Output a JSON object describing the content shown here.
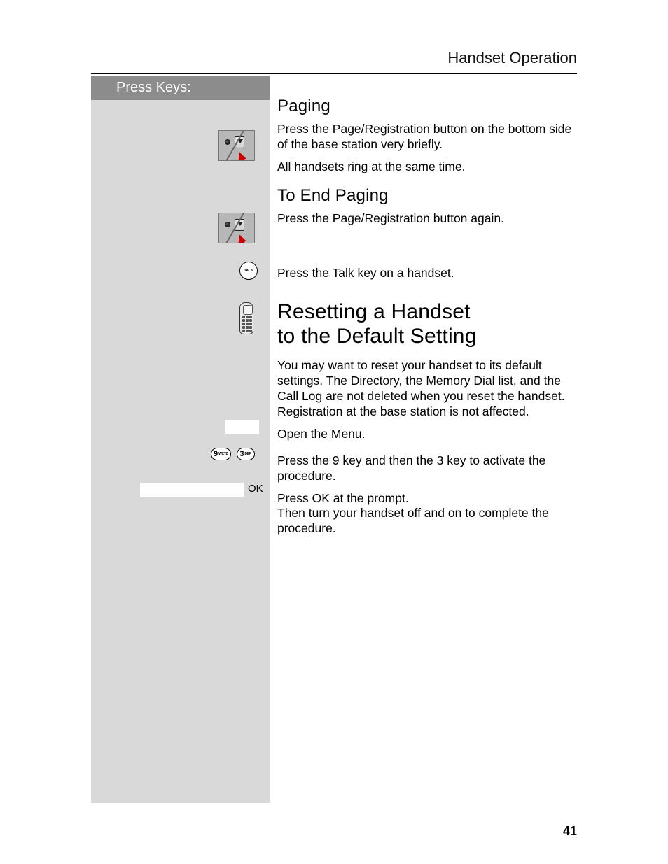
{
  "header": {
    "running_head": "Handset Operation"
  },
  "sidebar": {
    "title": "Press Keys:",
    "talk_key": "TALK",
    "keys": {
      "nine": {
        "digit": "9",
        "letters": "WXYZ"
      },
      "three": {
        "digit": "3",
        "letters": "DEF"
      }
    },
    "ok_label": "OK"
  },
  "sections": {
    "paging": {
      "title": "Paging",
      "p1": "Press the Page/Registration button on the bottom side of the base station very briefly.",
      "p2": "All handsets ring at the same time."
    },
    "end_paging": {
      "title": "To End Paging",
      "p1": "Press the Page/Registration button again.",
      "p2": "Press the Talk key on a handset."
    },
    "reset": {
      "title_line1": "Resetting a Handset",
      "title_line2": "to the Default Setting",
      "intro": "You may want to reset your handset to its default settings. The Directory, the Memory Dial list, and the Call Log are not deleted when you reset the handset. Registration at the base station is not affected.",
      "step_open_menu": "Open the Menu.",
      "step_press_93": "Press the 9 key and then the 3 key to activate the procedure.",
      "step_press_ok": "Press OK at the prompt.",
      "step_power_cycle": "Then turn your handset off and on to complete the procedure."
    }
  },
  "footer": {
    "page_number": "41"
  }
}
